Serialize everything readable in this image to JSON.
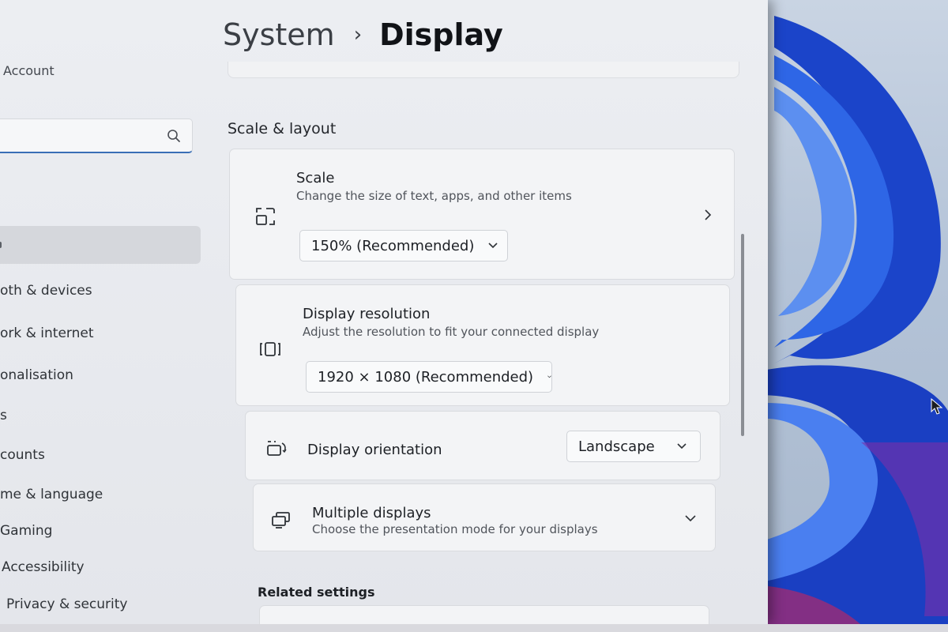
{
  "sidebar": {
    "account_label": "Account",
    "search": {
      "value": "",
      "placeholder": ""
    },
    "items": [
      {
        "label": "Bluetooth & devices",
        "visible": "oth & devices"
      },
      {
        "label": "Network & internet",
        "visible": "ork & internet"
      },
      {
        "label": "Personalisation",
        "visible": "onalisation"
      },
      {
        "label": "Apps",
        "visible": "s"
      },
      {
        "label": "Accounts",
        "visible": "counts"
      },
      {
        "label": "Time & language",
        "visible": "me & language"
      },
      {
        "label": "Gaming",
        "visible": "Gaming"
      },
      {
        "label": "Accessibility",
        "visible": "Accessibility"
      },
      {
        "label": "Privacy & security",
        "visible": "Privacy & security"
      }
    ]
  },
  "header": {
    "parent": "System",
    "separator": "›",
    "current": "Display"
  },
  "section": {
    "title": "Scale & layout"
  },
  "scale": {
    "title": "Scale",
    "description": "Change the size of text, apps, and other items",
    "selected": "150% (Recommended)",
    "icon": "scale-icon"
  },
  "resolution": {
    "title": "Display resolution",
    "description": "Adjust the resolution to fit your connected display",
    "selected": "1920 × 1080 (Recommended)",
    "icon": "resolution-icon"
  },
  "orientation": {
    "title": "Display orientation",
    "selected": "Landscape",
    "icon": "orientation-icon"
  },
  "multiple": {
    "title": "Multiple displays",
    "description": "Choose the presentation mode for your displays",
    "icon": "multiple-displays-icon"
  },
  "related": {
    "title": "Related settings"
  },
  "colors": {
    "accent": "#3a6fb6",
    "wallpaper_blue": "#1e4fd6"
  }
}
